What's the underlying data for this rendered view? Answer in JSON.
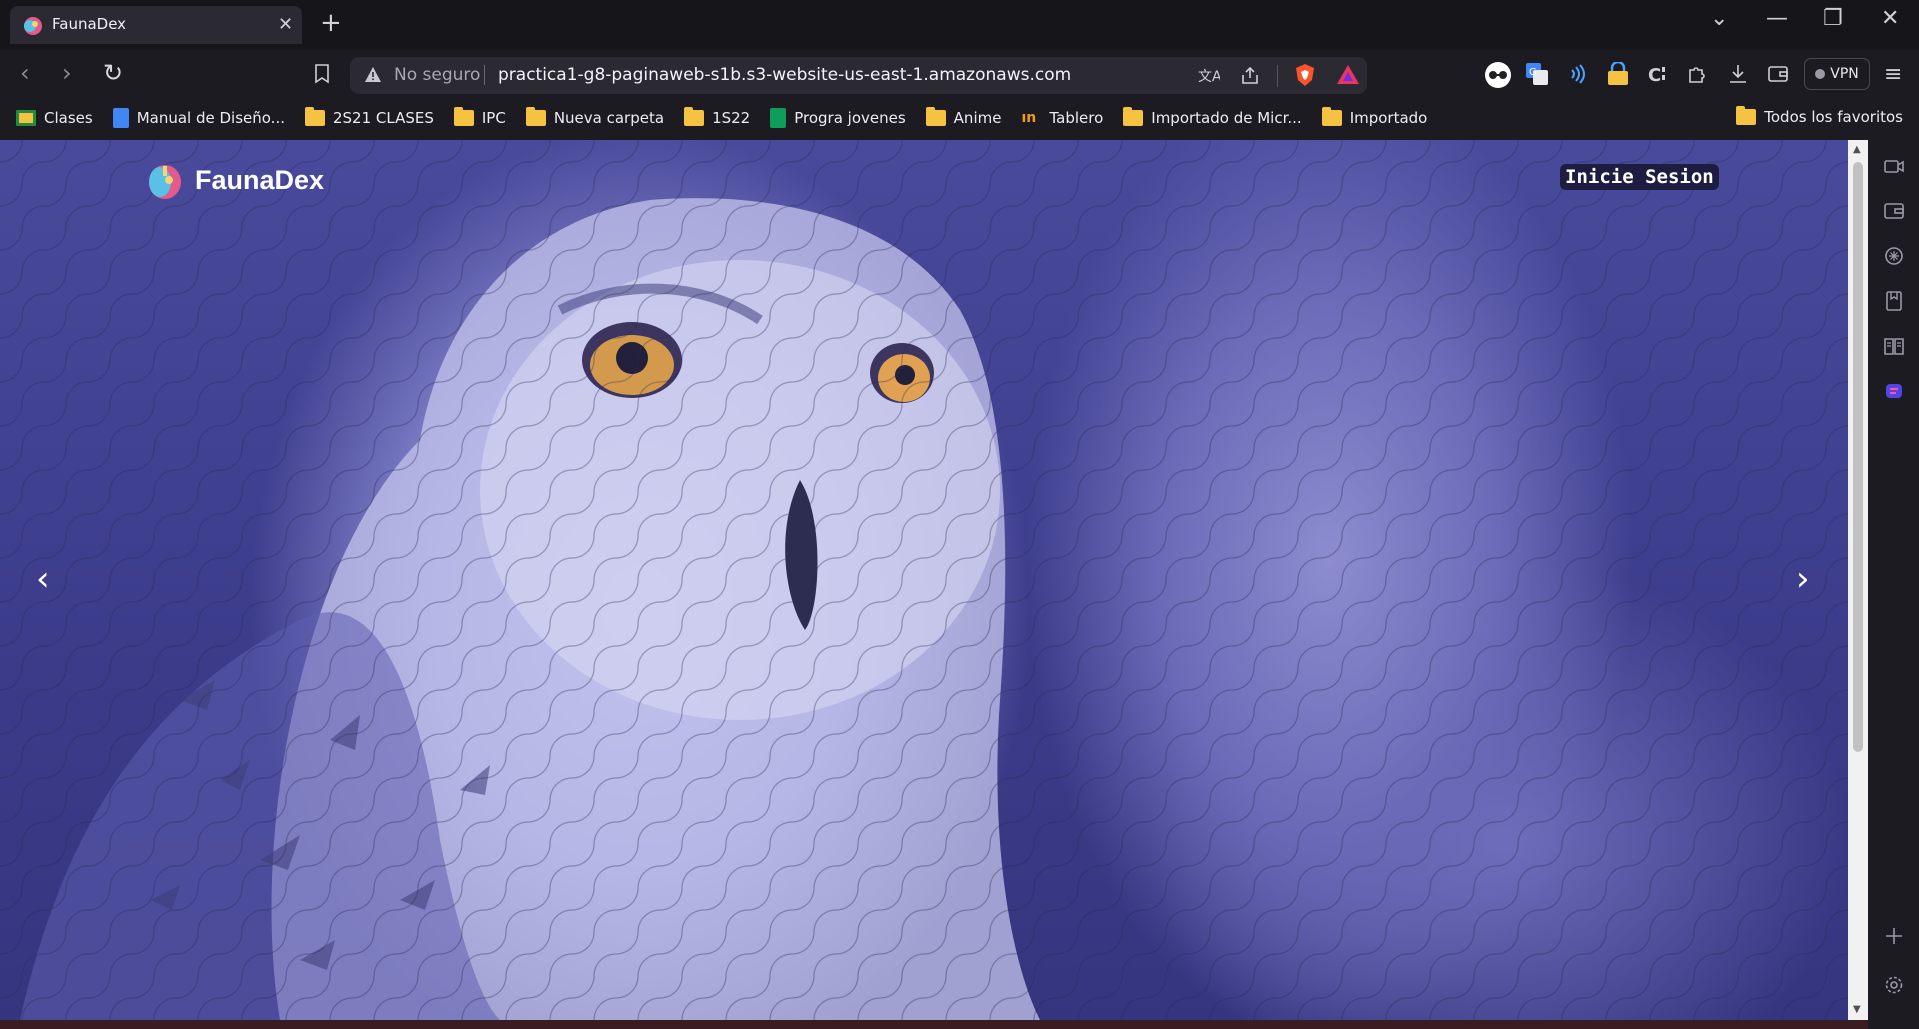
{
  "tab": {
    "title": "FaunaDex",
    "close_glyph": "✕"
  },
  "new_tab_glyph": "+",
  "window_controls": {
    "list": "⌄",
    "minimize": "—",
    "restore": "❐",
    "close": "✕"
  },
  "nav": {
    "back": "‹",
    "forward": "›",
    "reload": "↻"
  },
  "address_bar": {
    "security_label": "No seguro",
    "url": "practica1-g8-paginaweb-s1b.s3-website-us-east-1.amazonaws.com"
  },
  "vpn_label": "VPN",
  "menu_glyph": "≡",
  "bookmarks": [
    {
      "label": "Clases",
      "icon": "classroom-icon"
    },
    {
      "label": "Manual de Diseño...",
      "icon": "docs-icon"
    },
    {
      "label": "2S21 CLASES",
      "icon": "folder-icon"
    },
    {
      "label": "IPC",
      "icon": "folder-icon"
    },
    {
      "label": "Nueva carpeta",
      "icon": "folder-icon"
    },
    {
      "label": "1S22",
      "icon": "folder-icon"
    },
    {
      "label": "Progra jovenes",
      "icon": "sheets-icon"
    },
    {
      "label": "Anime",
      "icon": "folder-icon"
    },
    {
      "label": "Tablero",
      "icon": "tablero-icon"
    },
    {
      "label": "Importado de Micr...",
      "icon": "folder-icon"
    },
    {
      "label": "Importado",
      "icon": "folder-icon"
    }
  ],
  "all_bookmarks_label": "Todos los favoritos",
  "site": {
    "brand": "FaunaDex",
    "login_button": "Inicie Sesion",
    "carousel_prev": "‹",
    "carousel_next": "›"
  },
  "colors": {
    "accent_brave": "#fb542b",
    "page_tint": "#4a4a9c",
    "folder": "#f5c242"
  }
}
